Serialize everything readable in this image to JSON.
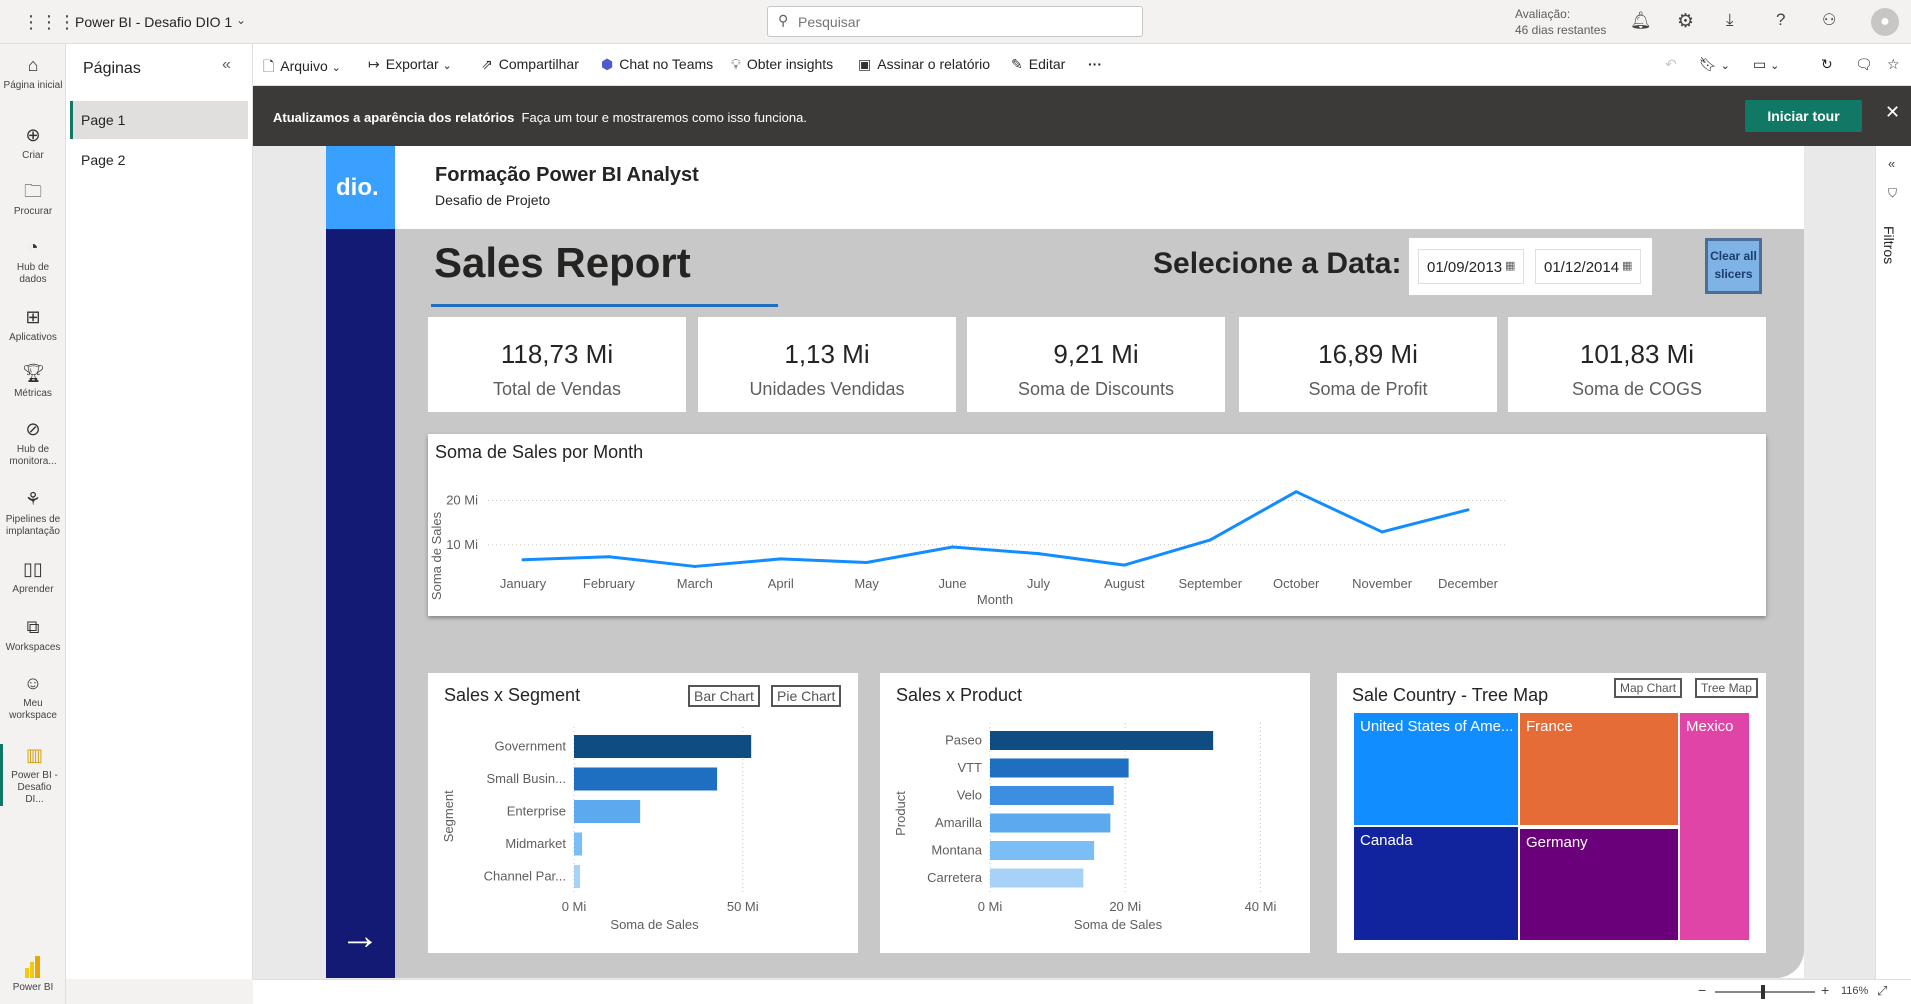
{
  "app": {
    "title": "Power BI - Desafio DIO 1",
    "search_placeholder": "Pesquisar",
    "trial_label": "Avaliação:",
    "trial_days": "46 dias restantes"
  },
  "leftnav": [
    {
      "label": "Página inicial",
      "icon": "home-icon"
    },
    {
      "label": "Criar",
      "icon": "plus-circle-icon"
    },
    {
      "label": "Procurar",
      "icon": "folder-icon"
    },
    {
      "label": "Hub de dados",
      "icon": "data-hub-icon"
    },
    {
      "label": "Aplicativos",
      "icon": "apps-icon"
    },
    {
      "label": "Métricas",
      "icon": "trophy-icon"
    },
    {
      "label": "Hub de monitora...",
      "icon": "monitor-icon"
    },
    {
      "label": "Pipelines de implantação",
      "icon": "rocket-icon"
    },
    {
      "label": "Aprender",
      "icon": "book-icon"
    },
    {
      "label": "Workspaces",
      "icon": "workspaces-icon"
    },
    {
      "label": "Meu workspace",
      "icon": "user-icon"
    },
    {
      "label": "Power BI - Desafio DI...",
      "icon": "report-icon"
    }
  ],
  "brand": "Power BI",
  "pages_panel": {
    "title": "Páginas",
    "pages": [
      "Page 1",
      "Page 2"
    ]
  },
  "toolbar": {
    "arquivo": "Arquivo",
    "exportar": "Exportar",
    "compartilhar": "Compartilhar",
    "chat_teams": "Chat no Teams",
    "insights": "Obter insights",
    "assinar": "Assinar o relatório",
    "editar": "Editar",
    "more": "···"
  },
  "banner": {
    "bold": "Atualizamos a aparência dos relatórios",
    "text": "Faça um tour e mostraremos como isso funciona.",
    "button": "Iniciar tour"
  },
  "filters_label": "Filtros",
  "zoom": "116%",
  "report": {
    "logo": "dio.",
    "header_title": "Formação Power BI Analyst",
    "header_subtitle": "Desafio de Projeto",
    "title": "Sales Report",
    "date_label": "Selecione a Data:",
    "date_start": "01/09/2013",
    "date_end": "01/12/2014",
    "clear_button": "Clear all slicers",
    "kpis": [
      {
        "value": "118,73 Mi",
        "label": "Total de Vendas"
      },
      {
        "value": "1,13 Mi",
        "label": "Unidades Vendidas"
      },
      {
        "value": "9,21 Mi",
        "label": "Soma de Discounts"
      },
      {
        "value": "16,89 Mi",
        "label": "Soma de Profit"
      },
      {
        "value": "101,83 Mi",
        "label": "Soma de COGS"
      }
    ],
    "segment_title": "Sales x Segment",
    "segment_btn_bar": "Bar Chart",
    "segment_btn_pie": "Pie Chart",
    "product_title": "Sales x Product",
    "country_title": "Sale Country - Tree Map",
    "country_btn_map": "Map Chart",
    "country_btn_tree": "Tree Map",
    "treemap": [
      {
        "label": "United States of Ame...",
        "color": "#118DFF"
      },
      {
        "label": "France",
        "color": "#E66C37"
      },
      {
        "label": "Mexico",
        "color": "#E044A7"
      },
      {
        "label": "Canada",
        "color": "#12239E"
      },
      {
        "label": "Germany",
        "color": "#6B007B"
      }
    ]
  },
  "chart_data": [
    {
      "type": "line",
      "title": "Soma de Sales por Month",
      "xlabel": "Month",
      "ylabel": "Soma de Sales",
      "categories": [
        "January",
        "February",
        "March",
        "April",
        "May",
        "June",
        "July",
        "August",
        "September",
        "October",
        "November",
        "December"
      ],
      "values": [
        6.6,
        7.3,
        5.1,
        6.8,
        6.0,
        9.5,
        8.0,
        5.4,
        11.1,
        22.0,
        12.9,
        17.9
      ],
      "yticks": [
        "10 Mi",
        "20 Mi"
      ],
      "ytick_values": [
        10,
        20
      ],
      "ylim": [
        0,
        26
      ],
      "color": "#118DFF"
    },
    {
      "type": "bar",
      "orientation": "horizontal",
      "title": "Sales x Segment",
      "xlabel": "Soma de Sales",
      "ylabel": "Segment",
      "categories": [
        "Government",
        "Small Busin...",
        "Enterprise",
        "Midmarket",
        "Channel Par..."
      ],
      "values": [
        52.5,
        42.4,
        19.6,
        2.4,
        1.8
      ],
      "colors": [
        "#0F4C81",
        "#1E6FC2",
        "#5CA9F0",
        "#7BBEF5",
        "#A6D2F7"
      ],
      "xticks": [
        "0 Mi",
        "50 Mi"
      ],
      "xtick_values": [
        0,
        50
      ],
      "xlim": [
        0,
        56
      ]
    },
    {
      "type": "bar",
      "orientation": "horizontal",
      "title": "Sales x Product",
      "xlabel": "Soma de Sales",
      "ylabel": "Product",
      "categories": [
        "Paseo",
        "VTT",
        "Velo",
        "Amarilla",
        "Montana",
        "Carretera"
      ],
      "values": [
        33.0,
        20.5,
        18.3,
        17.8,
        15.4,
        13.8
      ],
      "colors": [
        "#0F4C81",
        "#1E6FC2",
        "#3C8FE0",
        "#5CA9F0",
        "#7BBEF5",
        "#A6D2F7"
      ],
      "xticks": [
        "0 Mi",
        "20 Mi",
        "40 Mi"
      ],
      "xtick_values": [
        0,
        20,
        40
      ],
      "xlim": [
        0,
        42
      ]
    }
  ]
}
